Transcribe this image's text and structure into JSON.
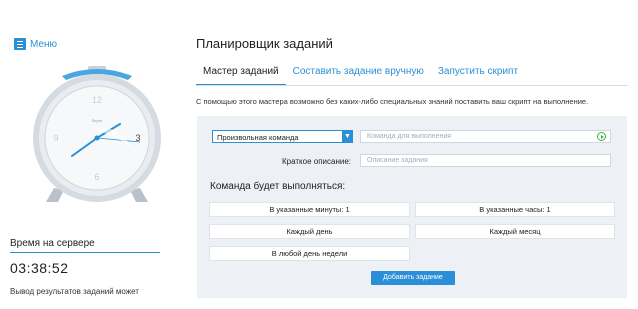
{
  "sidebar": {
    "menu_label": "Меню",
    "clock": {
      "numbers": [
        "12",
        "3",
        "6",
        "9"
      ],
      "brand": "Ѕерег",
      "accent": "#2a8fd6"
    },
    "server_time_title": "Время на сервере",
    "server_time": "03:38:52",
    "note": "Вывод результатов заданий может"
  },
  "main": {
    "title": "Планировщик заданий",
    "tabs": [
      {
        "label": "Мастер заданий",
        "active": true
      },
      {
        "label": "Составить задание вручную",
        "active": false
      },
      {
        "label": "Запустить скрипт",
        "active": false
      }
    ],
    "intro": "С помощью этого мастера возможно без каких-либо специальных знаний поставить ваш скрипт на выполнение.",
    "command_select": {
      "value": "Произвольная команда"
    },
    "command_input": {
      "placeholder": "Команда для выполнения"
    },
    "description": {
      "label": "Краткое описание:",
      "placeholder": "Описание задания"
    },
    "schedule_title": "Команда будет выполняться:",
    "options": {
      "minutes": "В указанные минуты: 1",
      "hours": "В указанные часы: 1",
      "daily": "Каждый день",
      "monthly": "Каждый месяц",
      "weekday": "В любой день недели"
    },
    "add_button": "Добавить задание"
  },
  "colors": {
    "accent": "#2a8fd6",
    "panel": "#edf1f5",
    "play": "#3bb34a"
  }
}
